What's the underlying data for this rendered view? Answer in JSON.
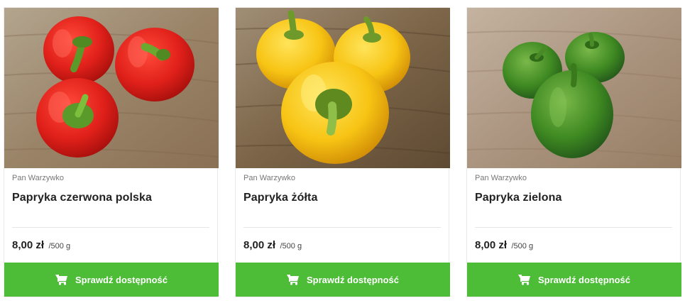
{
  "products": [
    {
      "vendor": "Pan Warzywko",
      "name": "Papryka czerwona polska",
      "price": "8,00 zł",
      "unit": "/500 g",
      "button_label": "Sprawdź dostępność",
      "image": "red-bell-peppers"
    },
    {
      "vendor": "Pan Warzywko",
      "name": "Papryka żółta",
      "price": "8,00 zł",
      "unit": "/500 g",
      "button_label": "Sprawdź dostępność",
      "image": "yellow-bell-peppers"
    },
    {
      "vendor": "Pan Warzywko",
      "name": "Papryka zielona",
      "price": "8,00 zł",
      "unit": "/500 g",
      "button_label": "Sprawdź dostępność",
      "image": "green-bell-peppers"
    }
  ],
  "colors": {
    "button": "#4dbd37",
    "button_text": "#ffffff",
    "title_text": "#222222",
    "vendor_text": "#777777"
  },
  "icons": {
    "button": "cart-icon"
  }
}
